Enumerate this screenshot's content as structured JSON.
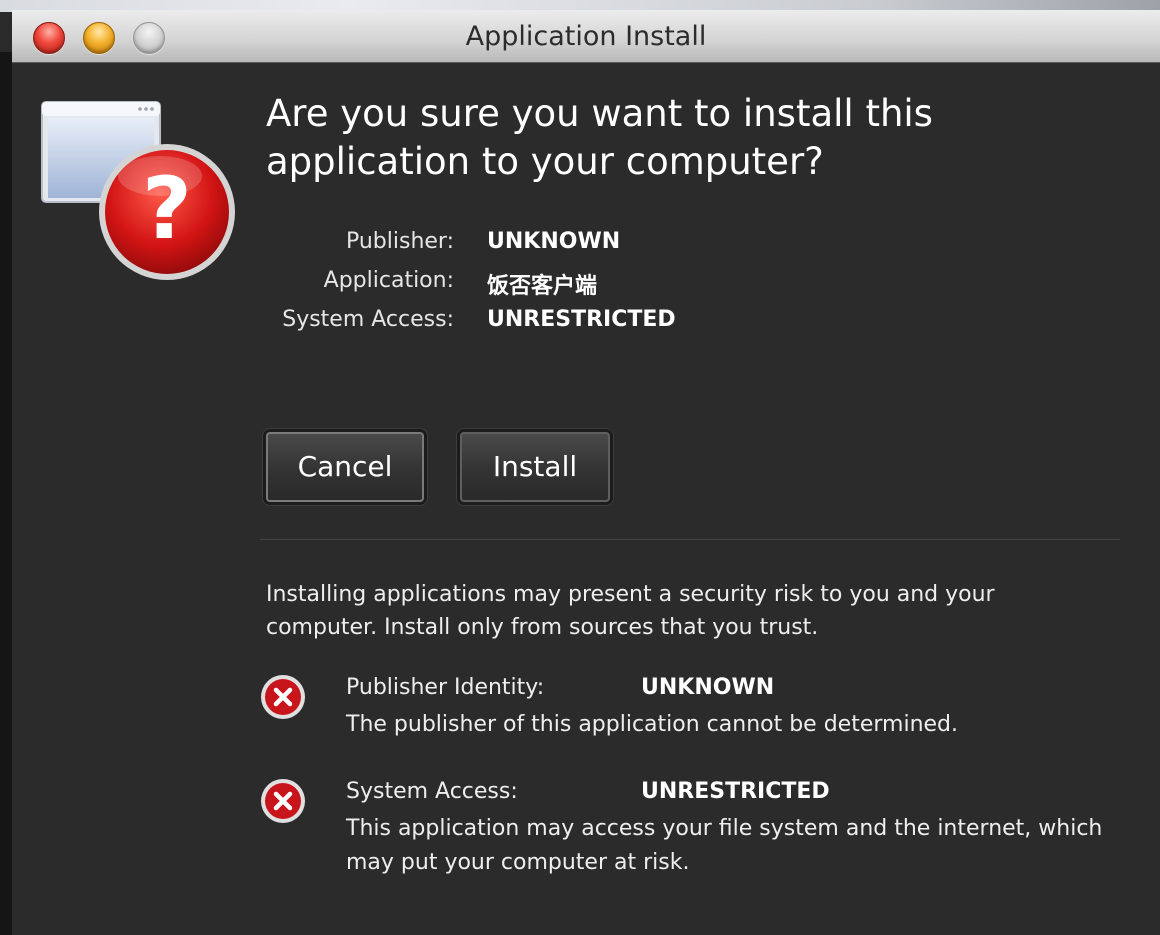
{
  "window": {
    "title": "Application Install"
  },
  "dialog": {
    "headline_line1": "Are you sure you want to install this",
    "headline_line2": "application to your computer?",
    "details": [
      {
        "label": "Publisher:",
        "value": "UNKNOWN"
      },
      {
        "label": "Application:",
        "value": "饭否客户端"
      },
      {
        "label": "System Access:",
        "value": "UNRESTRICTED"
      }
    ],
    "buttons": {
      "cancel": "Cancel",
      "install": "Install"
    },
    "warning": "Installing applications may present a security risk to you and your computer. Install only from sources that you trust.",
    "risks": [
      {
        "label": "Publisher Identity:",
        "value": "UNKNOWN",
        "description": "The publisher of this application cannot be determined.",
        "icon": "error-x-icon"
      },
      {
        "label": "System Access:",
        "value": "UNRESTRICTED",
        "description": "This application may access your file system and the internet, which may put your computer at risk.",
        "icon": "error-x-icon"
      }
    ]
  },
  "colors": {
    "background": "#2b2b2b",
    "risk_icon": "#c8141b",
    "alert_icon": "#cc1515"
  }
}
